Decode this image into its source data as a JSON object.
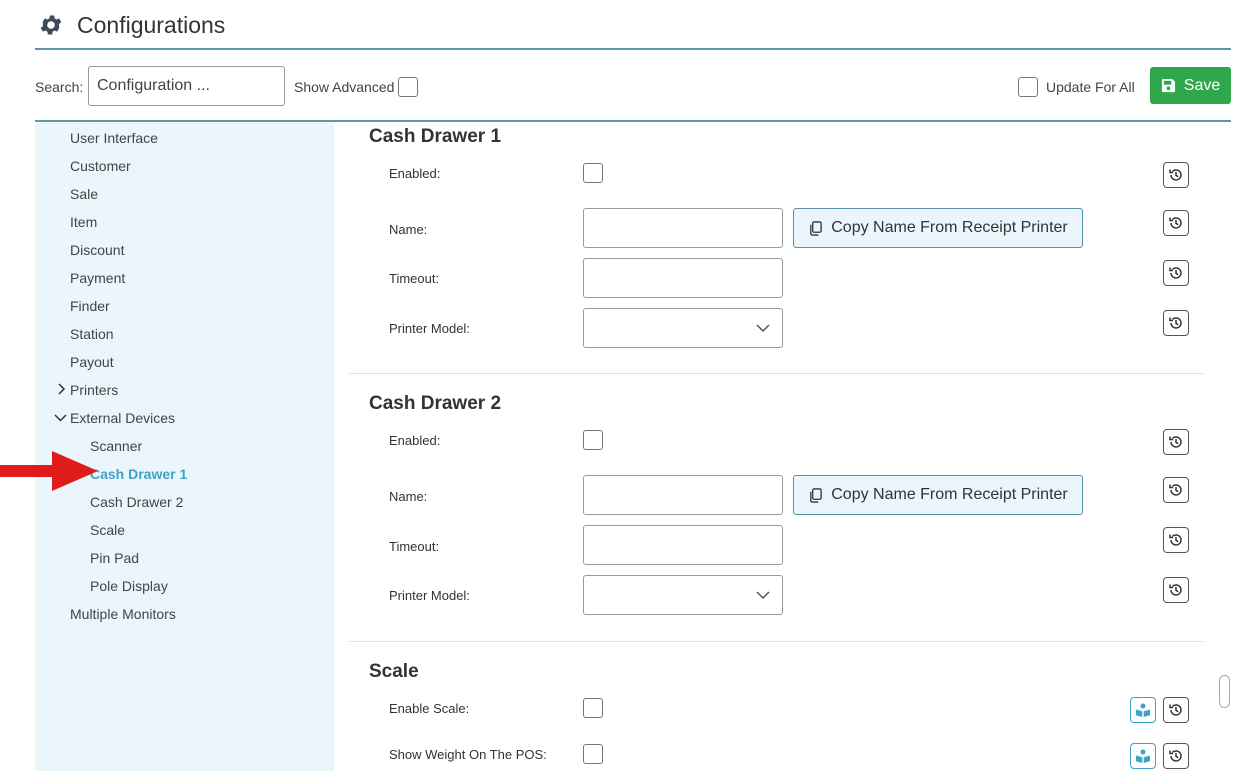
{
  "header": {
    "title": "Configurations",
    "icon": "gear-icon"
  },
  "toolbar": {
    "search_label": "Search:",
    "search_value": "Configuration ...",
    "show_advanced_label": "Show Advanced",
    "show_advanced_checked": false,
    "update_for_all_label": "Update For All",
    "update_for_all_checked": false,
    "save_label": "Save",
    "save_color": "#2ea84a"
  },
  "sidebar": {
    "items": [
      {
        "label": "User Interface"
      },
      {
        "label": "Customer"
      },
      {
        "label": "Sale"
      },
      {
        "label": "Item"
      },
      {
        "label": "Discount"
      },
      {
        "label": "Payment"
      },
      {
        "label": "Finder"
      },
      {
        "label": "Station"
      },
      {
        "label": "Payout"
      },
      {
        "label": "Printers",
        "expanded": false
      },
      {
        "label": "External Devices",
        "expanded": true
      },
      {
        "label": "Scanner"
      },
      {
        "label": "Cash Drawer 1",
        "active": true
      },
      {
        "label": "Cash Drawer 2"
      },
      {
        "label": "Scale"
      },
      {
        "label": "Pin Pad"
      },
      {
        "label": "Pole Display"
      },
      {
        "label": "Multiple Monitors"
      }
    ]
  },
  "sections": [
    {
      "title": "Cash Drawer 1",
      "fields": {
        "enabled_label": "Enabled:",
        "name_label": "Name:",
        "timeout_label": "Timeout:",
        "printer_model_label": "Printer Model:",
        "copy_button_label": "Copy Name From Receipt Printer",
        "name_value": "",
        "timeout_value": "",
        "printer_model_value": ""
      }
    },
    {
      "title": "Cash Drawer 2",
      "fields": {
        "enabled_label": "Enabled:",
        "name_label": "Name:",
        "timeout_label": "Timeout:",
        "printer_model_label": "Printer Model:",
        "copy_button_label": "Copy Name From Receipt Printer",
        "name_value": "",
        "timeout_value": "",
        "printer_model_value": ""
      }
    },
    {
      "title": "Scale",
      "fields": {
        "enable_scale_label": "Enable Scale:",
        "show_weight_label": "Show Weight On The POS:"
      }
    }
  ],
  "colors": {
    "accent_line": "#5b9aa5",
    "sidebar_bg": "#ebf5fc",
    "active_nav": "#3fa3c9",
    "arrow": "#e01b1b"
  }
}
